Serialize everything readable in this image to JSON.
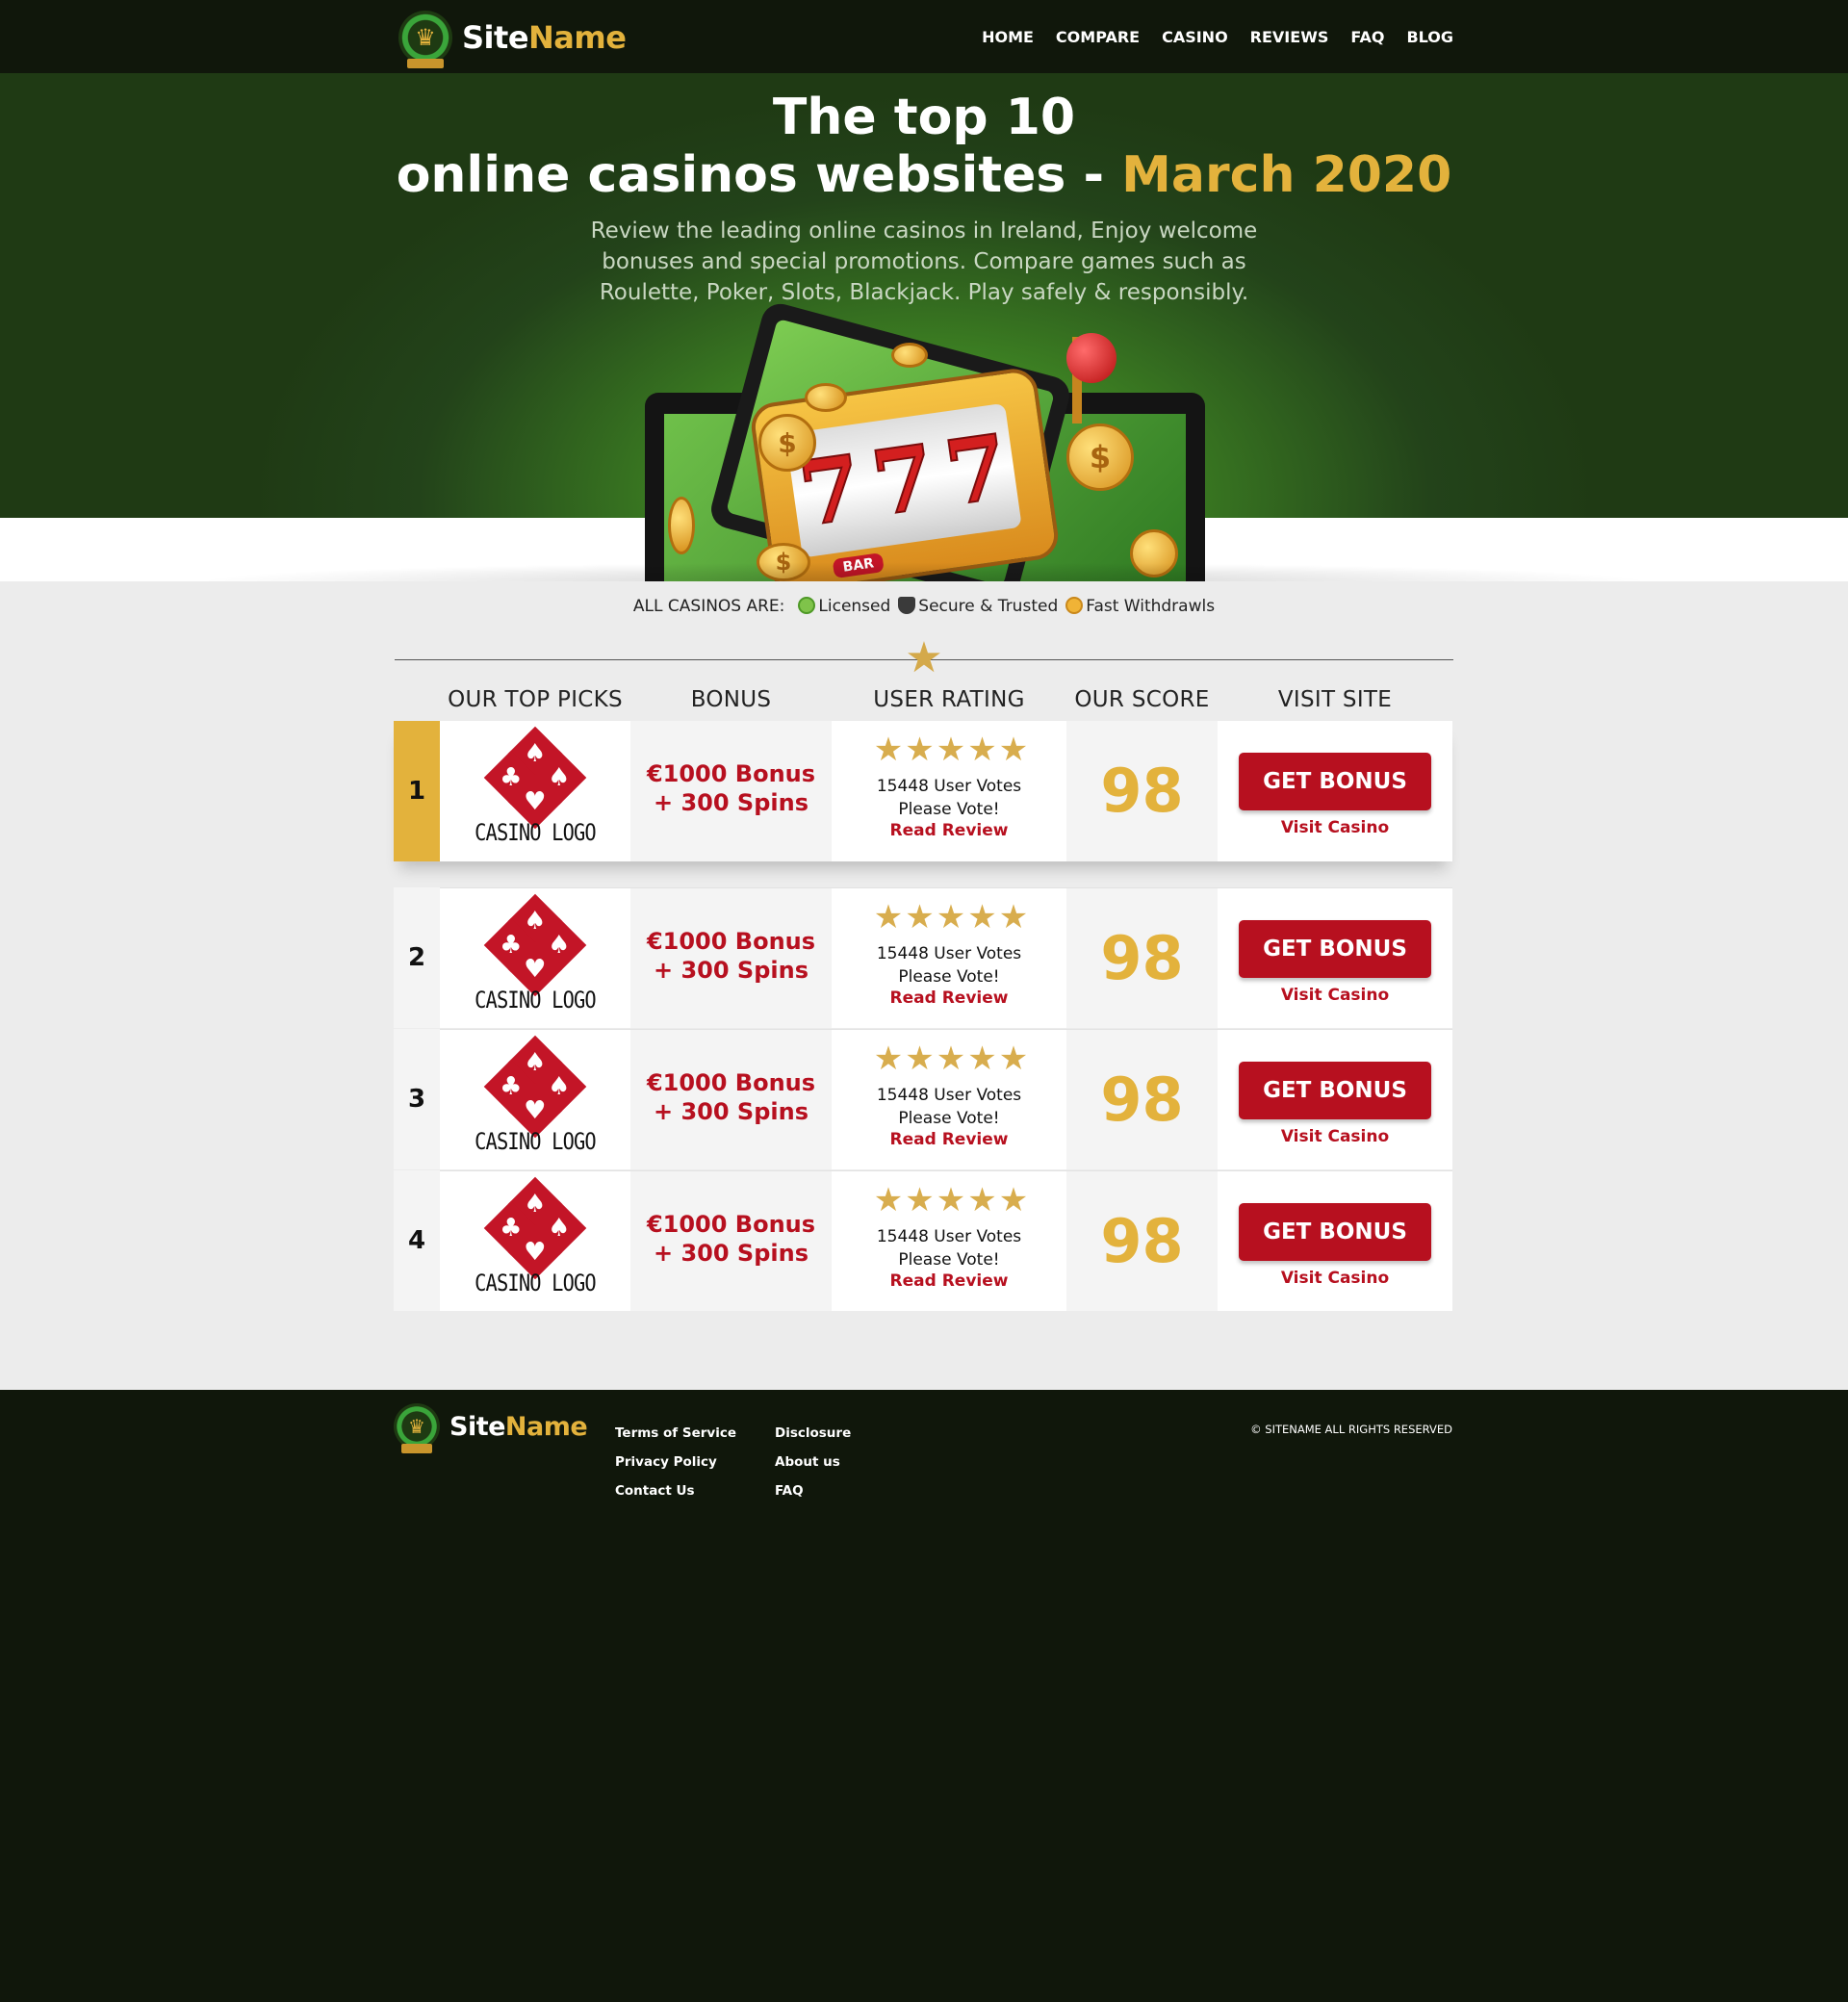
{
  "header": {
    "logo": {
      "part1": "Site",
      "part2": "Name"
    },
    "nav": [
      "HOME",
      "COMPARE",
      "CASINO",
      "REVIEWS",
      "FAQ",
      "BLOG"
    ]
  },
  "hero": {
    "title_line1": "The top 10",
    "title_line2": "online casinos websites - ",
    "title_highlight": "March 2020",
    "lead": "Review the leading online casinos in Ireland, Enjoy welcome bonuses and special promotions. Compare games such as Roulette, Poker, Slots, Blackjack. Play safely & responsibly.",
    "slot_reels": [
      "7",
      "7",
      "7"
    ],
    "slot_label": "BAR"
  },
  "features": {
    "lead": "ALL CASINOS ARE:",
    "items": [
      "Licensed",
      "Secure & Trusted",
      "Fast Withdrawls"
    ]
  },
  "table": {
    "headers": [
      "OUR TOP PICKS",
      "BONUS",
      "USER RATING",
      "OUR SCORE",
      "VISIT SITE"
    ],
    "rows": [
      {
        "rank": "1",
        "logo": "CASINO LOGO",
        "bonus1": "€1000 Bonus",
        "bonus2": "+ 300 Spins",
        "stars": 5,
        "votes": "15448 User Votes",
        "vote_cta": "Please Vote!",
        "review": "Read Review",
        "score": "98",
        "button": "GET BONUS",
        "visit": "Visit Casino"
      },
      {
        "rank": "2",
        "logo": "CASINO LOGO",
        "bonus1": "€1000 Bonus",
        "bonus2": "+ 300 Spins",
        "stars": 5,
        "votes": "15448 User Votes",
        "vote_cta": "Please Vote!",
        "review": "Read Review",
        "score": "98",
        "button": "GET BONUS",
        "visit": "Visit Casino"
      },
      {
        "rank": "3",
        "logo": "CASINO LOGO",
        "bonus1": "€1000 Bonus",
        "bonus2": "+ 300 Spins",
        "stars": 5,
        "votes": "15448 User Votes",
        "vote_cta": "Please Vote!",
        "review": "Read Review",
        "score": "98",
        "button": "GET BONUS",
        "visit": "Visit Casino"
      },
      {
        "rank": "4",
        "logo": "CASINO LOGO",
        "bonus1": "€1000 Bonus",
        "bonus2": "+ 300 Spins",
        "stars": 5,
        "votes": "15448 User Votes",
        "vote_cta": "Please Vote!",
        "review": "Read Review",
        "score": "98",
        "button": "GET BONUS",
        "visit": "Visit Casino"
      }
    ]
  },
  "footer": {
    "logo": {
      "part1": "Site",
      "part2": "Name"
    },
    "col1": [
      "Terms of Service",
      "Privacy Policy",
      "Contact Us"
    ],
    "col2": [
      "Disclosure",
      "About us",
      "FAQ"
    ],
    "copyright": "© SITENAME ALL RIGHTS RESERVED"
  },
  "colors": {
    "gold": "#e3b23c",
    "red": "#b7101f",
    "dark": "#10170b",
    "green": "#3c7f22"
  }
}
